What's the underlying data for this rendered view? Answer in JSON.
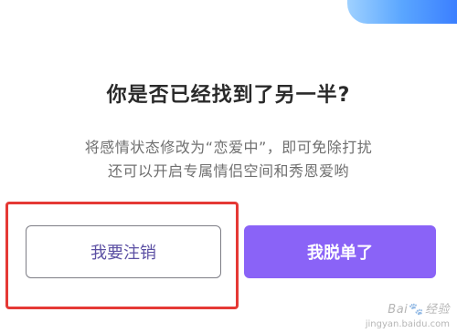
{
  "dialog": {
    "title": "你是否已经找到了另一半?",
    "description_line1": "将感情状态修改为“恋爱中”，即可免除打扰",
    "description_line2": "还可以开启专属情侣空间和秀恩爱哟",
    "cancel_label": "我要注销",
    "confirm_label": "我脱单了"
  },
  "watermark": {
    "text_left": "Bai",
    "paw": "🐾",
    "text_right": "经验",
    "sub": "jingyan.baidu.com"
  },
  "colors": {
    "confirm_bg": "#8a63f7",
    "cancel_text": "#5b4fa3",
    "highlight": "#e53935"
  }
}
